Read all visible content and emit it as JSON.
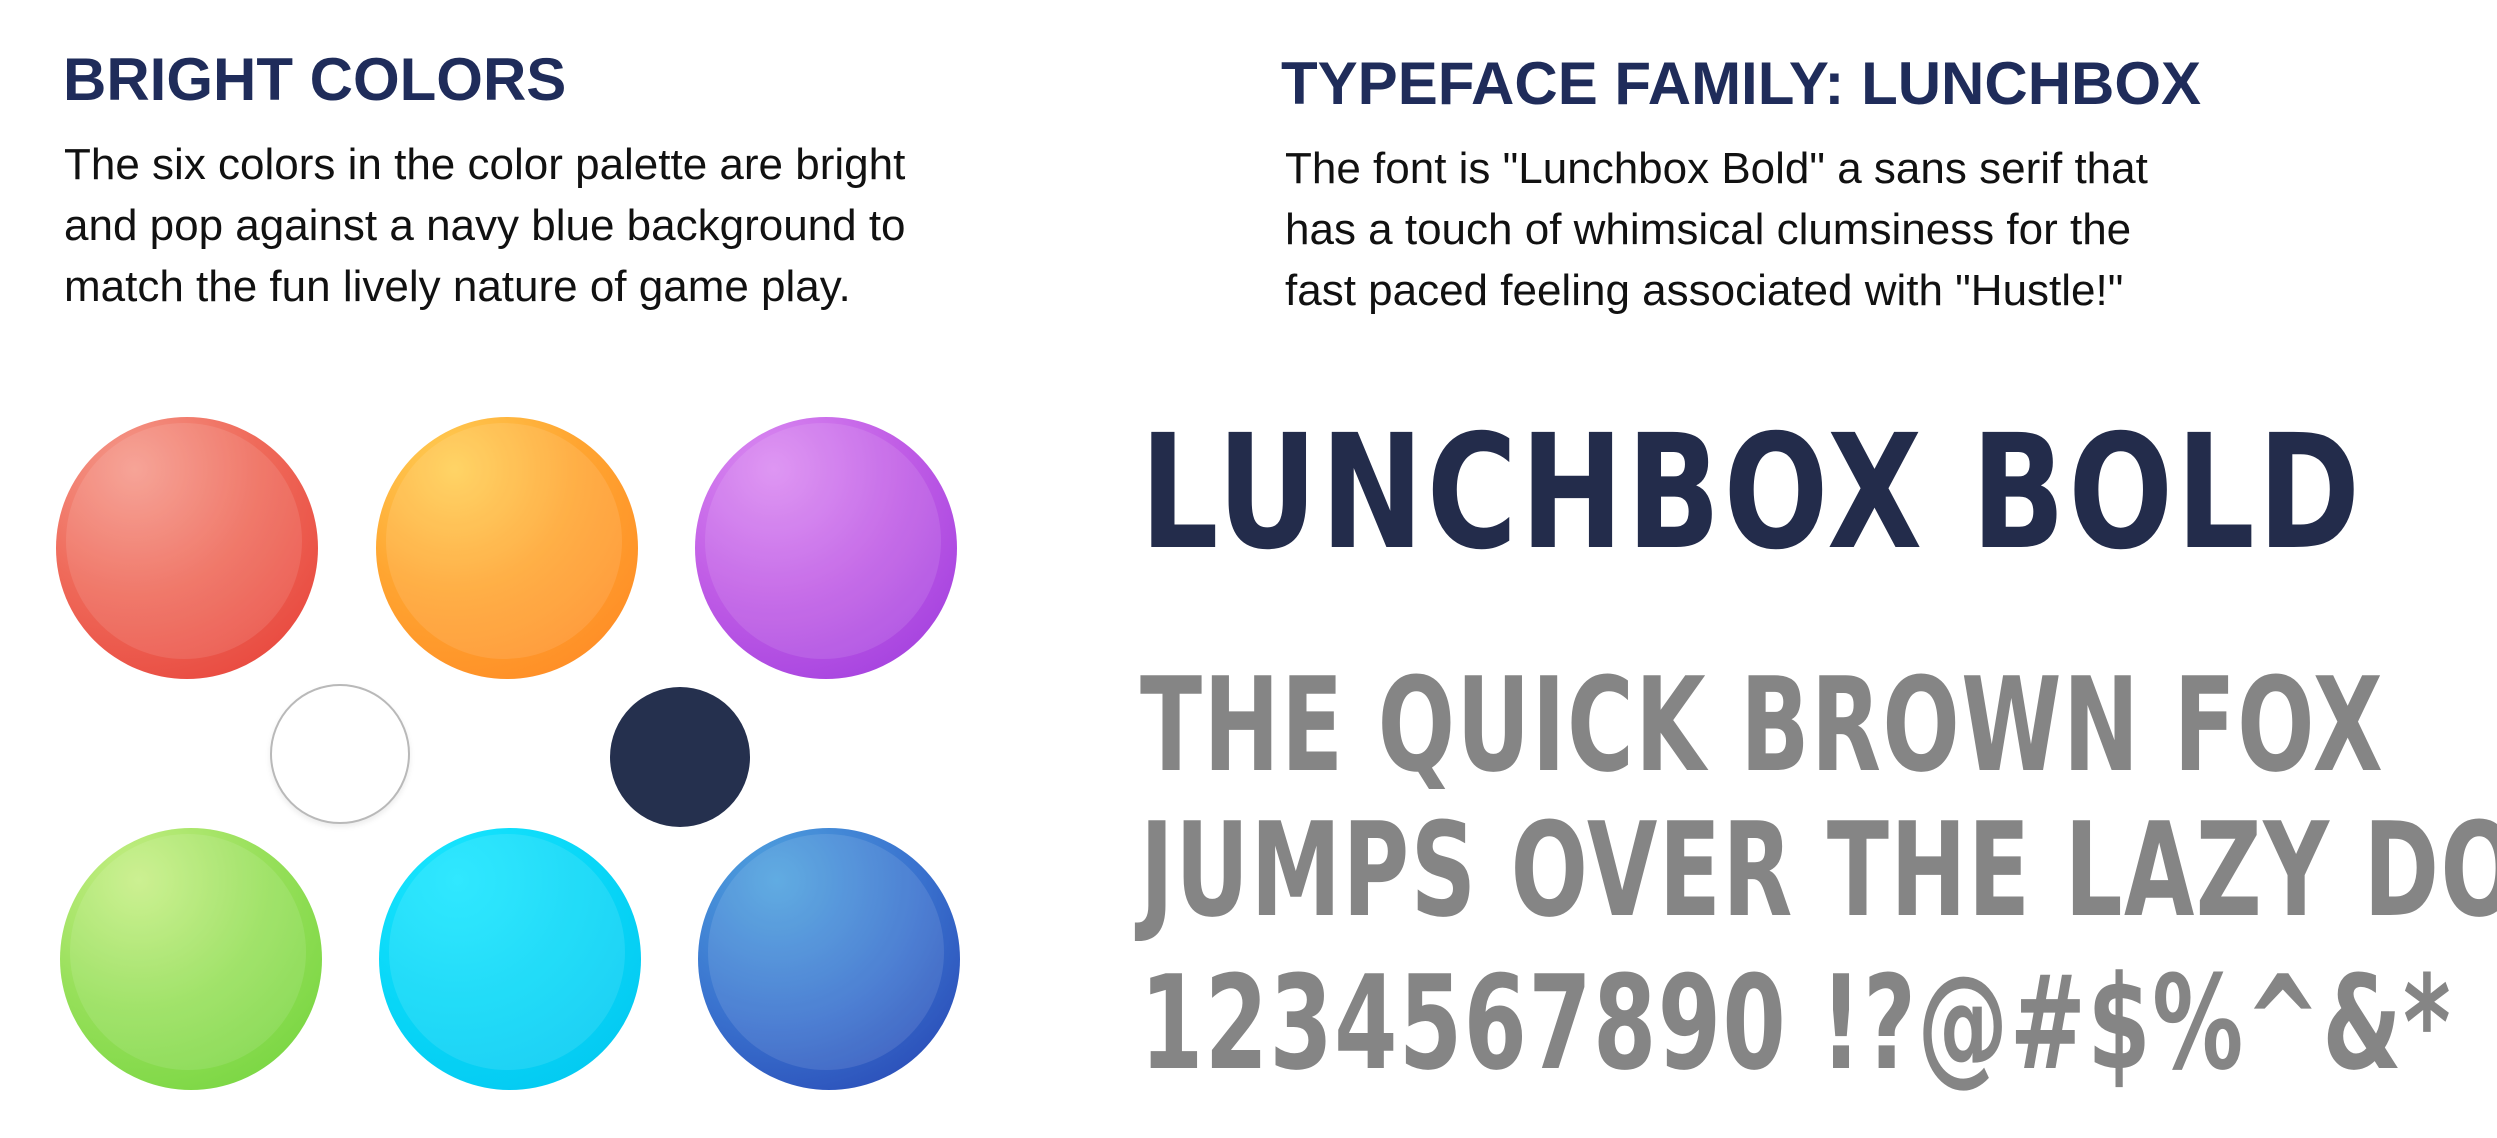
{
  "left": {
    "heading": "BRIGHT COLORS",
    "body_lines": [
      "The six colors in the color palette are bright",
      "and pop against a navy blue background to",
      "match the fun lively nature of game play."
    ]
  },
  "right": {
    "heading": "TYPEFACE FAMILY: LUNCHBOX",
    "body_lines": [
      "The font is \"Lunchbox Bold\" a sans serif that",
      "has a touch of whimsical clumsiness for the",
      "fast paced feeling associated with \"Hustle!\""
    ]
  },
  "palette": [
    {
      "name": "red",
      "color": "#ef5a4d"
    },
    {
      "name": "orange",
      "color": "#ff9a2e"
    },
    {
      "name": "purple",
      "color": "#b44ee4"
    },
    {
      "name": "white",
      "color": "#ffffff"
    },
    {
      "name": "navy",
      "color": "#25304e"
    },
    {
      "name": "green",
      "color": "#8fdc52"
    },
    {
      "name": "cyan",
      "color": "#08d6f7"
    },
    {
      "name": "blue",
      "color": "#3366c9"
    }
  ],
  "specimen": {
    "title": "LUNCHBOX BOLD",
    "line1": "THE QUICK BROWN FOX",
    "line2": "JUMPS OVER THE LAZY DOG",
    "line3": "1234567890 !?@#$%^&*"
  }
}
